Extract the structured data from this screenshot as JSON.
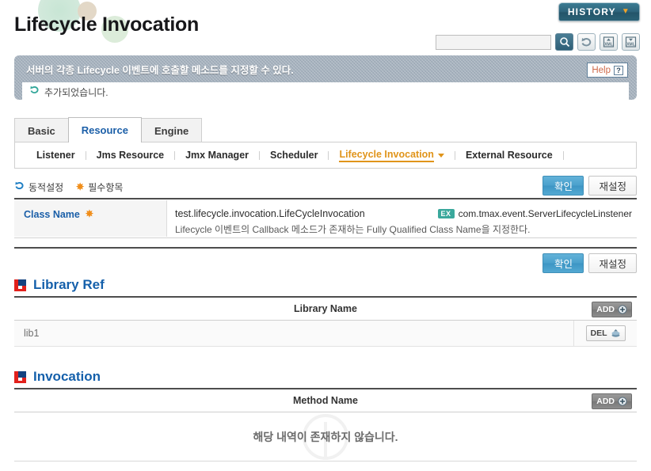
{
  "header": {
    "title": "Lifecycle Invocation",
    "history_label": "HISTORY",
    "history_chevron": "chevron-down-icon"
  },
  "toolbar": {
    "search_value": "",
    "search_placeholder": "",
    "buttons": [
      {
        "name": "search-icon",
        "title": "Search"
      },
      {
        "name": "refresh-icon",
        "title": "Refresh"
      },
      {
        "name": "xml-upload-icon",
        "title": "XML Upload"
      },
      {
        "name": "xml-download-icon",
        "title": "XML Download"
      }
    ]
  },
  "banner": {
    "description": "서버의 각종 Lifecycle 이벤트에 호출할 메소드를 지정할 수 있다.",
    "notice": "추가되었습니다.",
    "notice_icon": "refresh-icon",
    "help_label": "Help",
    "help_icon": "question-mark-icon"
  },
  "tabs": [
    {
      "label": "Basic",
      "active": false
    },
    {
      "label": "Resource",
      "active": true
    },
    {
      "label": "Engine",
      "active": false
    }
  ],
  "subnav": [
    {
      "label": "Listener",
      "active": false
    },
    {
      "label": "Jms Resource",
      "active": false
    },
    {
      "label": "Jmx Manager",
      "active": false
    },
    {
      "label": "Scheduler",
      "active": false
    },
    {
      "label": "Lifecycle Invocation",
      "active": true
    },
    {
      "label": "External Resource",
      "active": false
    }
  ],
  "actionbar": {
    "dynamic_label": "동적설정",
    "dynamic_icon": "refresh-icon",
    "required_label": "필수항목",
    "required_icon": "asterisk-icon",
    "confirm_label": "확인",
    "reset_label": "재설정"
  },
  "properties": [
    {
      "label": "Class Name",
      "required": true,
      "value": "test.lifecycle.invocation.LifeCycleInvocation",
      "example_badge": "EX",
      "example": "com.tmax.event.ServerLifecycleLinstener",
      "description": "Lifecycle 이벤트의 Callback 메소드가 존재하는 Fully Qualified Class Name을 지정한다."
    }
  ],
  "footer_actions": {
    "confirm_label": "확인",
    "reset_label": "재설정"
  },
  "library_ref": {
    "title": "Library Ref",
    "column": "Library Name",
    "add_label": "ADD",
    "del_label": "DEL",
    "rows": [
      {
        "name": "lib1"
      }
    ]
  },
  "invocation": {
    "title": "Invocation",
    "column": "Method Name",
    "add_label": "ADD",
    "empty_message": "해당 내역이 존재하지 않습니다."
  },
  "colors": {
    "accent_blue": "#1560ab",
    "active_orange": "#e0941a",
    "required_orange": "#f08a12",
    "confirm_blue": "#4aa0cc",
    "banner_gray": "#9aa7b4",
    "logo_red": "#e2211c",
    "logo_blue": "#14427f",
    "ex_teal": "#3aa89c"
  }
}
